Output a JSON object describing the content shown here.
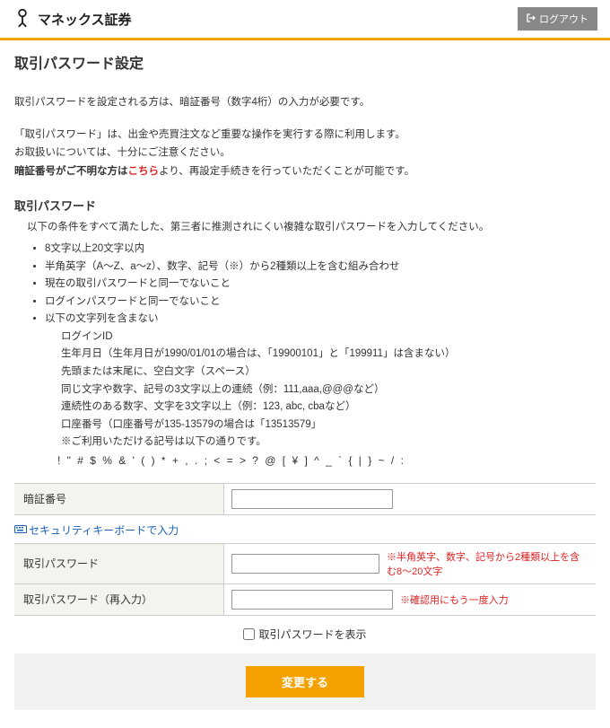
{
  "brand": {
    "name": "マネックス証券"
  },
  "header": {
    "logout": "ログアウト"
  },
  "page": {
    "title": "取引パスワード設定",
    "intro1": "取引パスワードを設定される方は、暗証番号（数字4桁）の入力が必要です。",
    "intro2": "「取引パスワード」は、出金や売買注文など重要な操作を実行する際に利用します。",
    "intro3": "お取扱いについては、十分にご注意ください。",
    "intro4a": "暗証番号がご不明な方は",
    "intro4link": "こちら",
    "intro4b": "より、再設定手続きを行っていただくことが可能です。"
  },
  "rules": {
    "heading": "取引パスワード",
    "desc": "以下の条件をすべて満たした、第三者に推測されにくい複雑な取引パスワードを入力してください。",
    "items": [
      "8文字以上20文字以内",
      "半角英字（A～Z、a～z）、数字、記号（※）から2種類以上を含む組み合わせ",
      "現在の取引パスワードと同一でないこと",
      "ログインパスワードと同一でないこと",
      "以下の文字列を含まない"
    ],
    "nested": [
      "ログインID",
      "生年月日（生年月日が1990/01/01の場合は、「19900101」と「199911」は含まない）",
      "先頭または末尾に、空白文字（スペース）",
      "同じ文字や数字、記号の3文字以上の連続（例：111,aaa,@@@など）",
      "連続性のある数字、文字を3文字以上（例：123, abc, cbaなど）",
      "口座番号（口座番号が135-13579の場合は「13513579」",
      "※ご利用いただける記号は以下の通りです。"
    ],
    "symbols": "! \" # $ % & ' ( ) * + , . ; < = > ? @ [ ¥ ] ^ _ ` { | } ~ / :"
  },
  "form": {
    "pin_label": "暗証番号",
    "keyboard_link": "セキュリティキーボードで入力",
    "pw_label": "取引パスワード",
    "pw_hint": "※半角英字、数字、記号から2種類以上を含む8～20文字",
    "pw2_label": "取引パスワード（再入力）",
    "pw2_hint": "※確認用にもう一度入力",
    "show_pw": "取引パスワードを表示",
    "submit": "変更する"
  }
}
